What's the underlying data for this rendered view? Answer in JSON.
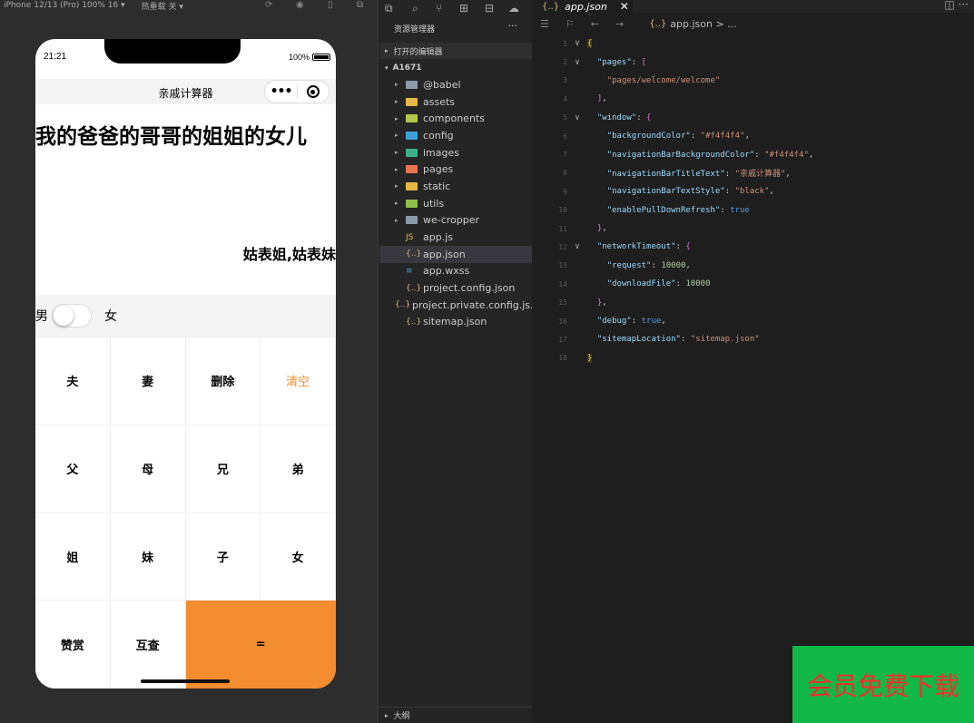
{
  "simulator": {
    "device_label": "iPhone 12/13 (Pro) 100% 16 ▾",
    "hot_reload_label": "热重载 关 ▾",
    "phone": {
      "time": "21:21",
      "battery": "100%",
      "nav_title": "亲戚计算器",
      "capsule_dots": "•••",
      "expression": "我的爸爸的哥哥的姐姐的女儿",
      "result": "姑表姐,姑表妹",
      "gender_male": "男",
      "gender_female": "女",
      "keys": [
        {
          "label": "夫"
        },
        {
          "label": "妻"
        },
        {
          "label": "删除"
        },
        {
          "label": "清空"
        },
        {
          "label": "父"
        },
        {
          "label": "母"
        },
        {
          "label": "兄"
        },
        {
          "label": "弟"
        },
        {
          "label": "姐"
        },
        {
          "label": "妹"
        },
        {
          "label": "子"
        },
        {
          "label": "女"
        },
        {
          "label": "赞赏"
        },
        {
          "label": "互查"
        },
        {
          "label": "="
        }
      ]
    }
  },
  "explorer": {
    "title": "资源管理器",
    "more": "···",
    "opened_editors": "打开的编辑器",
    "root": "A1671",
    "items": [
      {
        "label": "@babel",
        "folder": true,
        "color": "#8a9aa8"
      },
      {
        "label": "assets",
        "folder": true,
        "color": "#e5b743"
      },
      {
        "label": "components",
        "folder": true,
        "color": "#b3c84a"
      },
      {
        "label": "config",
        "folder": true,
        "color": "#3ea1d9"
      },
      {
        "label": "images",
        "folder": true,
        "color": "#3cb08a"
      },
      {
        "label": "pages",
        "folder": true,
        "color": "#e8774f"
      },
      {
        "label": "static",
        "folder": true,
        "color": "#e5b743"
      },
      {
        "label": "utils",
        "folder": true,
        "color": "#8fbf4a"
      },
      {
        "label": "we-cropper",
        "folder": true,
        "color": "#8a9aa8"
      },
      {
        "label": "app.js",
        "folder": false,
        "icon": "JS",
        "color": "#e5b743"
      },
      {
        "label": "app.json",
        "folder": false,
        "icon": "{..}",
        "color": "#d7ba7d",
        "selected": true
      },
      {
        "label": "app.wxss",
        "folder": false,
        "icon": "≡",
        "color": "#3ea1d9"
      },
      {
        "label": "project.config.json",
        "folder": false,
        "icon": "{..}",
        "color": "#d7ba7d"
      },
      {
        "label": "project.private.config.js...",
        "folder": false,
        "icon": "{..}",
        "color": "#d7ba7d"
      },
      {
        "label": "sitemap.json",
        "folder": false,
        "icon": "{..}",
        "color": "#d7ba7d"
      }
    ],
    "outline": "大纲"
  },
  "editor": {
    "tab_icon": "{..}",
    "tab_name": "app.json",
    "tab_close": "✕",
    "breadcrumb_icon": "{..}",
    "breadcrumb": "app.json > ...",
    "lines": [
      {
        "num": "1",
        "fold": "∨",
        "html": "<span class='cursor'>{</span>"
      },
      {
        "num": "2",
        "fold": "∨",
        "html": "  <span class='k'>\"pages\"</span><span class='p'>: </span><span class='br'>[</span>"
      },
      {
        "num": "3",
        "fold": "",
        "html": "    <span class='s'>\"pages/welcome/welcome\"</span>"
      },
      {
        "num": "4",
        "fold": "",
        "html": "  <span class='br'>]</span><span class='p'>,</span>"
      },
      {
        "num": "5",
        "fold": "∨",
        "html": "  <span class='k'>\"window\"</span><span class='p'>: </span><span class='br'>{</span>"
      },
      {
        "num": "6",
        "fold": "",
        "html": "    <span class='k'>\"backgroundColor\"</span><span class='p'>: </span><span class='s'>\"#f4f4f4\"</span><span class='p'>,</span>"
      },
      {
        "num": "7",
        "fold": "",
        "html": "    <span class='k'>\"navigationBarBackgroundColor\"</span><span class='p'>: </span><span class='s'>\"#f4f4f4\"</span><span class='p'>,</span>"
      },
      {
        "num": "8",
        "fold": "",
        "html": "    <span class='k'>\"navigationBarTitleText\"</span><span class='p'>: </span><span class='s'>\"亲戚计算器\"</span><span class='p'>,</span>"
      },
      {
        "num": "9",
        "fold": "",
        "html": "    <span class='k'>\"navigationBarTextStyle\"</span><span class='p'>: </span><span class='s'>\"black\"</span><span class='p'>,</span>"
      },
      {
        "num": "10",
        "fold": "",
        "html": "    <span class='k'>\"enablePullDownRefresh\"</span><span class='p'>: </span><span class='b'>true</span>"
      },
      {
        "num": "11",
        "fold": "",
        "html": "  <span class='br'>}</span><span class='p'>,</span>"
      },
      {
        "num": "12",
        "fold": "∨",
        "html": "  <span class='k'>\"networkTimeout\"</span><span class='p'>: </span><span class='br'>{</span>"
      },
      {
        "num": "13",
        "fold": "",
        "html": "    <span class='k'>\"request\"</span><span class='p'>: </span><span class='n'>10000</span><span class='p'>,</span>"
      },
      {
        "num": "14",
        "fold": "",
        "html": "    <span class='k'>\"downloadFile\"</span><span class='p'>: </span><span class='n'>10000</span>"
      },
      {
        "num": "15",
        "fold": "",
        "html": "  <span class='br'>}</span><span class='p'>,</span>"
      },
      {
        "num": "16",
        "fold": "",
        "html": "  <span class='k'>\"debug\"</span><span class='p'>: </span><span class='b'>true</span><span class='p'>,</span>"
      },
      {
        "num": "17",
        "fold": "",
        "html": "  <span class='k'>\"sitemapLocation\"</span><span class='p'>: </span><span class='s'>\"sitemap.json\"</span>"
      },
      {
        "num": "18",
        "fold": "",
        "html": "<span class='cursor'>}</span>"
      }
    ]
  },
  "ad_banner": "会员免费下载"
}
